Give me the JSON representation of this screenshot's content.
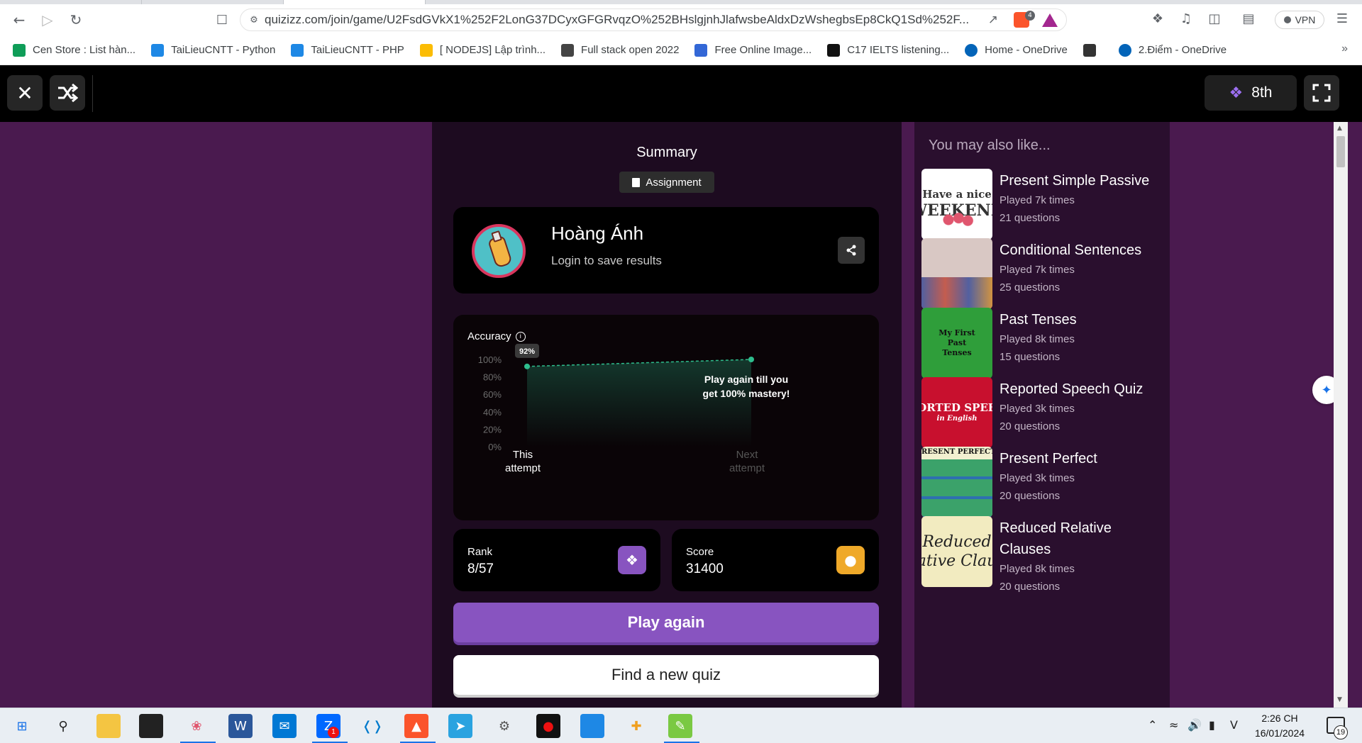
{
  "browser": {
    "url": "quizizz.com/join/game/U2FsdGVkX1%252F2LonG37DCyxGFGRvqzO%252BHslgjnhJlafwsbeAldxDzWshegbsEp8CkQ1Sd%252F...",
    "vpn_label": "VPN",
    "brave_badge": "4"
  },
  "bookmarks": [
    {
      "label": "Cen Store : List hàn...",
      "color": "#0f9d58"
    },
    {
      "label": "TaiLieuCNTT - Python",
      "color": "#1e88e5"
    },
    {
      "label": "TaiLieuCNTT - PHP",
      "color": "#1e88e5"
    },
    {
      "label": "[ NODEJS] Lập trình...",
      "color": "#fbbc04"
    },
    {
      "label": "Full stack open 2022",
      "color": "#444444"
    },
    {
      "label": "Free Online Image...",
      "color": "#3367d6"
    },
    {
      "label": "C17 IELTS listening...",
      "color": "#111111"
    },
    {
      "label": "Home - OneDrive",
      "color": "#0364b8"
    },
    {
      "label": "",
      "color": "#333333"
    },
    {
      "label": "2.Điểm - OneDrive",
      "color": "#0364b8"
    }
  ],
  "header": {
    "rank_label": "8th",
    "close_icon": "close-icon",
    "shuffle_icon": "shuffle-icon",
    "fullscreen_icon": "fullscreen-icon"
  },
  "summary": {
    "title": "Summary",
    "chip": "Assignment",
    "player_name": "Hoàng Ánh",
    "player_sub": "Login to save results",
    "accuracy_label": "Accuracy",
    "rank_label": "Rank",
    "rank_value": "8/57",
    "score_label": "Score",
    "score_value": "31400",
    "play_again": "Play again",
    "find_new": "Find a new quiz"
  },
  "chart_data": {
    "type": "line",
    "title": "Accuracy",
    "categories": [
      "This attempt",
      "Next attempt"
    ],
    "x_labels": [
      [
        "This",
        "attempt"
      ],
      [
        "Next",
        "attempt"
      ]
    ],
    "values": [
      92,
      100
    ],
    "point_label": "92%",
    "annotation": [
      "Play again till you",
      "get 100% mastery!"
    ],
    "yticks": [
      "100%",
      "80%",
      "60%",
      "40%",
      "20%",
      "0%"
    ],
    "ylim": [
      0,
      100
    ],
    "grid": false,
    "line_color": "#2ebd8d"
  },
  "recommendations": {
    "title": "You may also like...",
    "items": [
      {
        "name": "Present Simple Passive",
        "played": "Played 7k times",
        "questions": "21 questions",
        "thumb": [
          "Have a nice",
          "WEEKEND"
        ],
        "thumb_bg": "#ffffff",
        "thumb_fg": "#333333"
      },
      {
        "name": "Conditional Sentences",
        "played": "Played 7k times",
        "questions": "25 questions",
        "thumb": [],
        "thumb_bg": "#d9c8c4",
        "thumb_fg": "#333333"
      },
      {
        "name": "Past Tenses",
        "played": "Played 8k times",
        "questions": "15 questions",
        "thumb": [
          "My First",
          "Past",
          "Tenses"
        ],
        "thumb_bg": "#2f9e3a",
        "thumb_fg": "#111111"
      },
      {
        "name": "Reported Speech Quiz",
        "played": "Played 3k times",
        "questions": "20 questions",
        "thumb": [
          "PORTED SPEEC",
          "in English"
        ],
        "thumb_bg": "#c8102e",
        "thumb_fg": "#ffffff"
      },
      {
        "name": "Present Perfect",
        "played": "Played 3k times",
        "questions": "20 questions",
        "thumb": [
          "RESENT PERFECT TENS"
        ],
        "thumb_bg": "#3ba26a",
        "thumb_fg": "#111111"
      },
      {
        "name": "Reduced Relative Clauses",
        "played": "Played 8k times",
        "questions": "20 questions",
        "thumb": [
          "Reduced",
          "ative Clau"
        ],
        "thumb_bg": "#f2ebc0",
        "thumb_fg": "#222222"
      }
    ]
  },
  "taskbar": {
    "time": "2:26 CH",
    "date": "16/01/2024",
    "notifications": "19",
    "zalo_badge": "1"
  }
}
